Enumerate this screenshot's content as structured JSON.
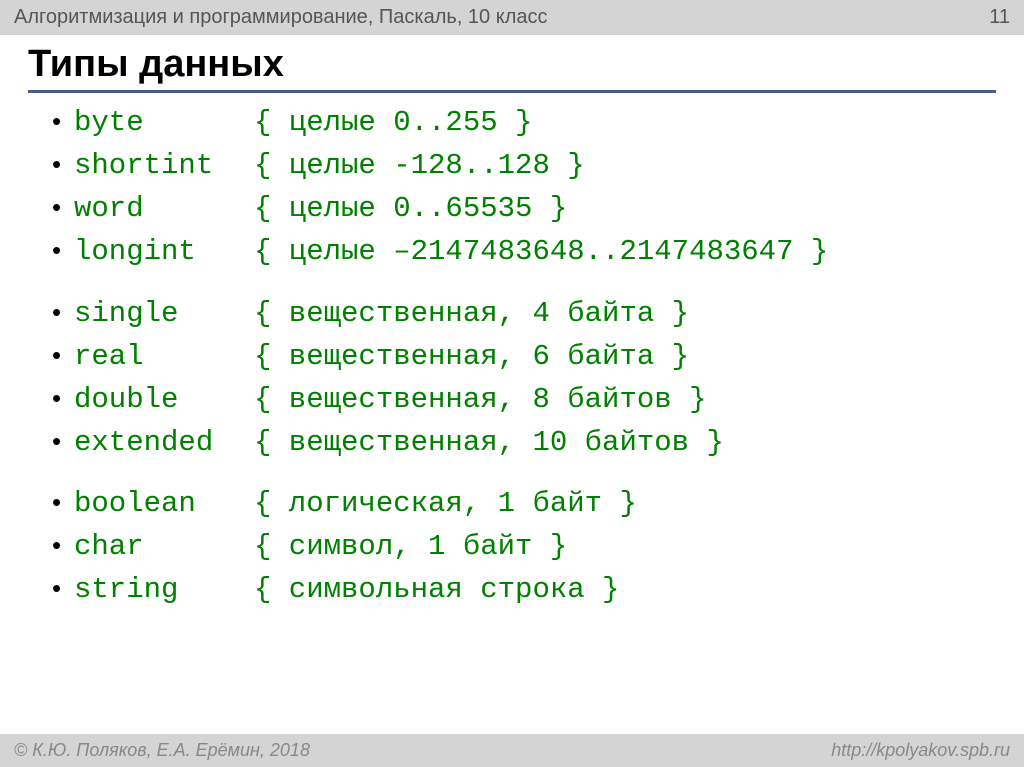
{
  "header": {
    "left": "Алгоритмизация и программирование, Паскаль, 10 класс",
    "page": "11"
  },
  "title": "Типы данных",
  "groups": [
    [
      {
        "name": "byte",
        "desc": "{ целые 0..255 }"
      },
      {
        "name": "shortint",
        "desc": "{ целые -128..128 }"
      },
      {
        "name": "word",
        "desc": "{ целые 0..65535 }"
      },
      {
        "name": "longint",
        "desc": "{ целые –2147483648..2147483647 }"
      }
    ],
    [
      {
        "name": "single",
        "desc": "{ вещественная, 4 байта }"
      },
      {
        "name": "real",
        "desc": "{ вещественная, 6 байта }"
      },
      {
        "name": "double",
        "desc": "{ вещественная, 8 байтов }"
      },
      {
        "name": "extended",
        "desc": "{ вещественная, 10 байтов }"
      }
    ],
    [
      {
        "name": "boolean",
        "desc": "{ логическая, 1 байт }"
      },
      {
        "name": "char",
        "desc": "{ символ, 1 байт }"
      },
      {
        "name": "string",
        "desc": "{ символьная строка }"
      }
    ]
  ],
  "footer": {
    "left": "© К.Ю. Поляков, Е.А. Ерёмин, 2018",
    "right": "http://kpolyakov.spb.ru"
  }
}
